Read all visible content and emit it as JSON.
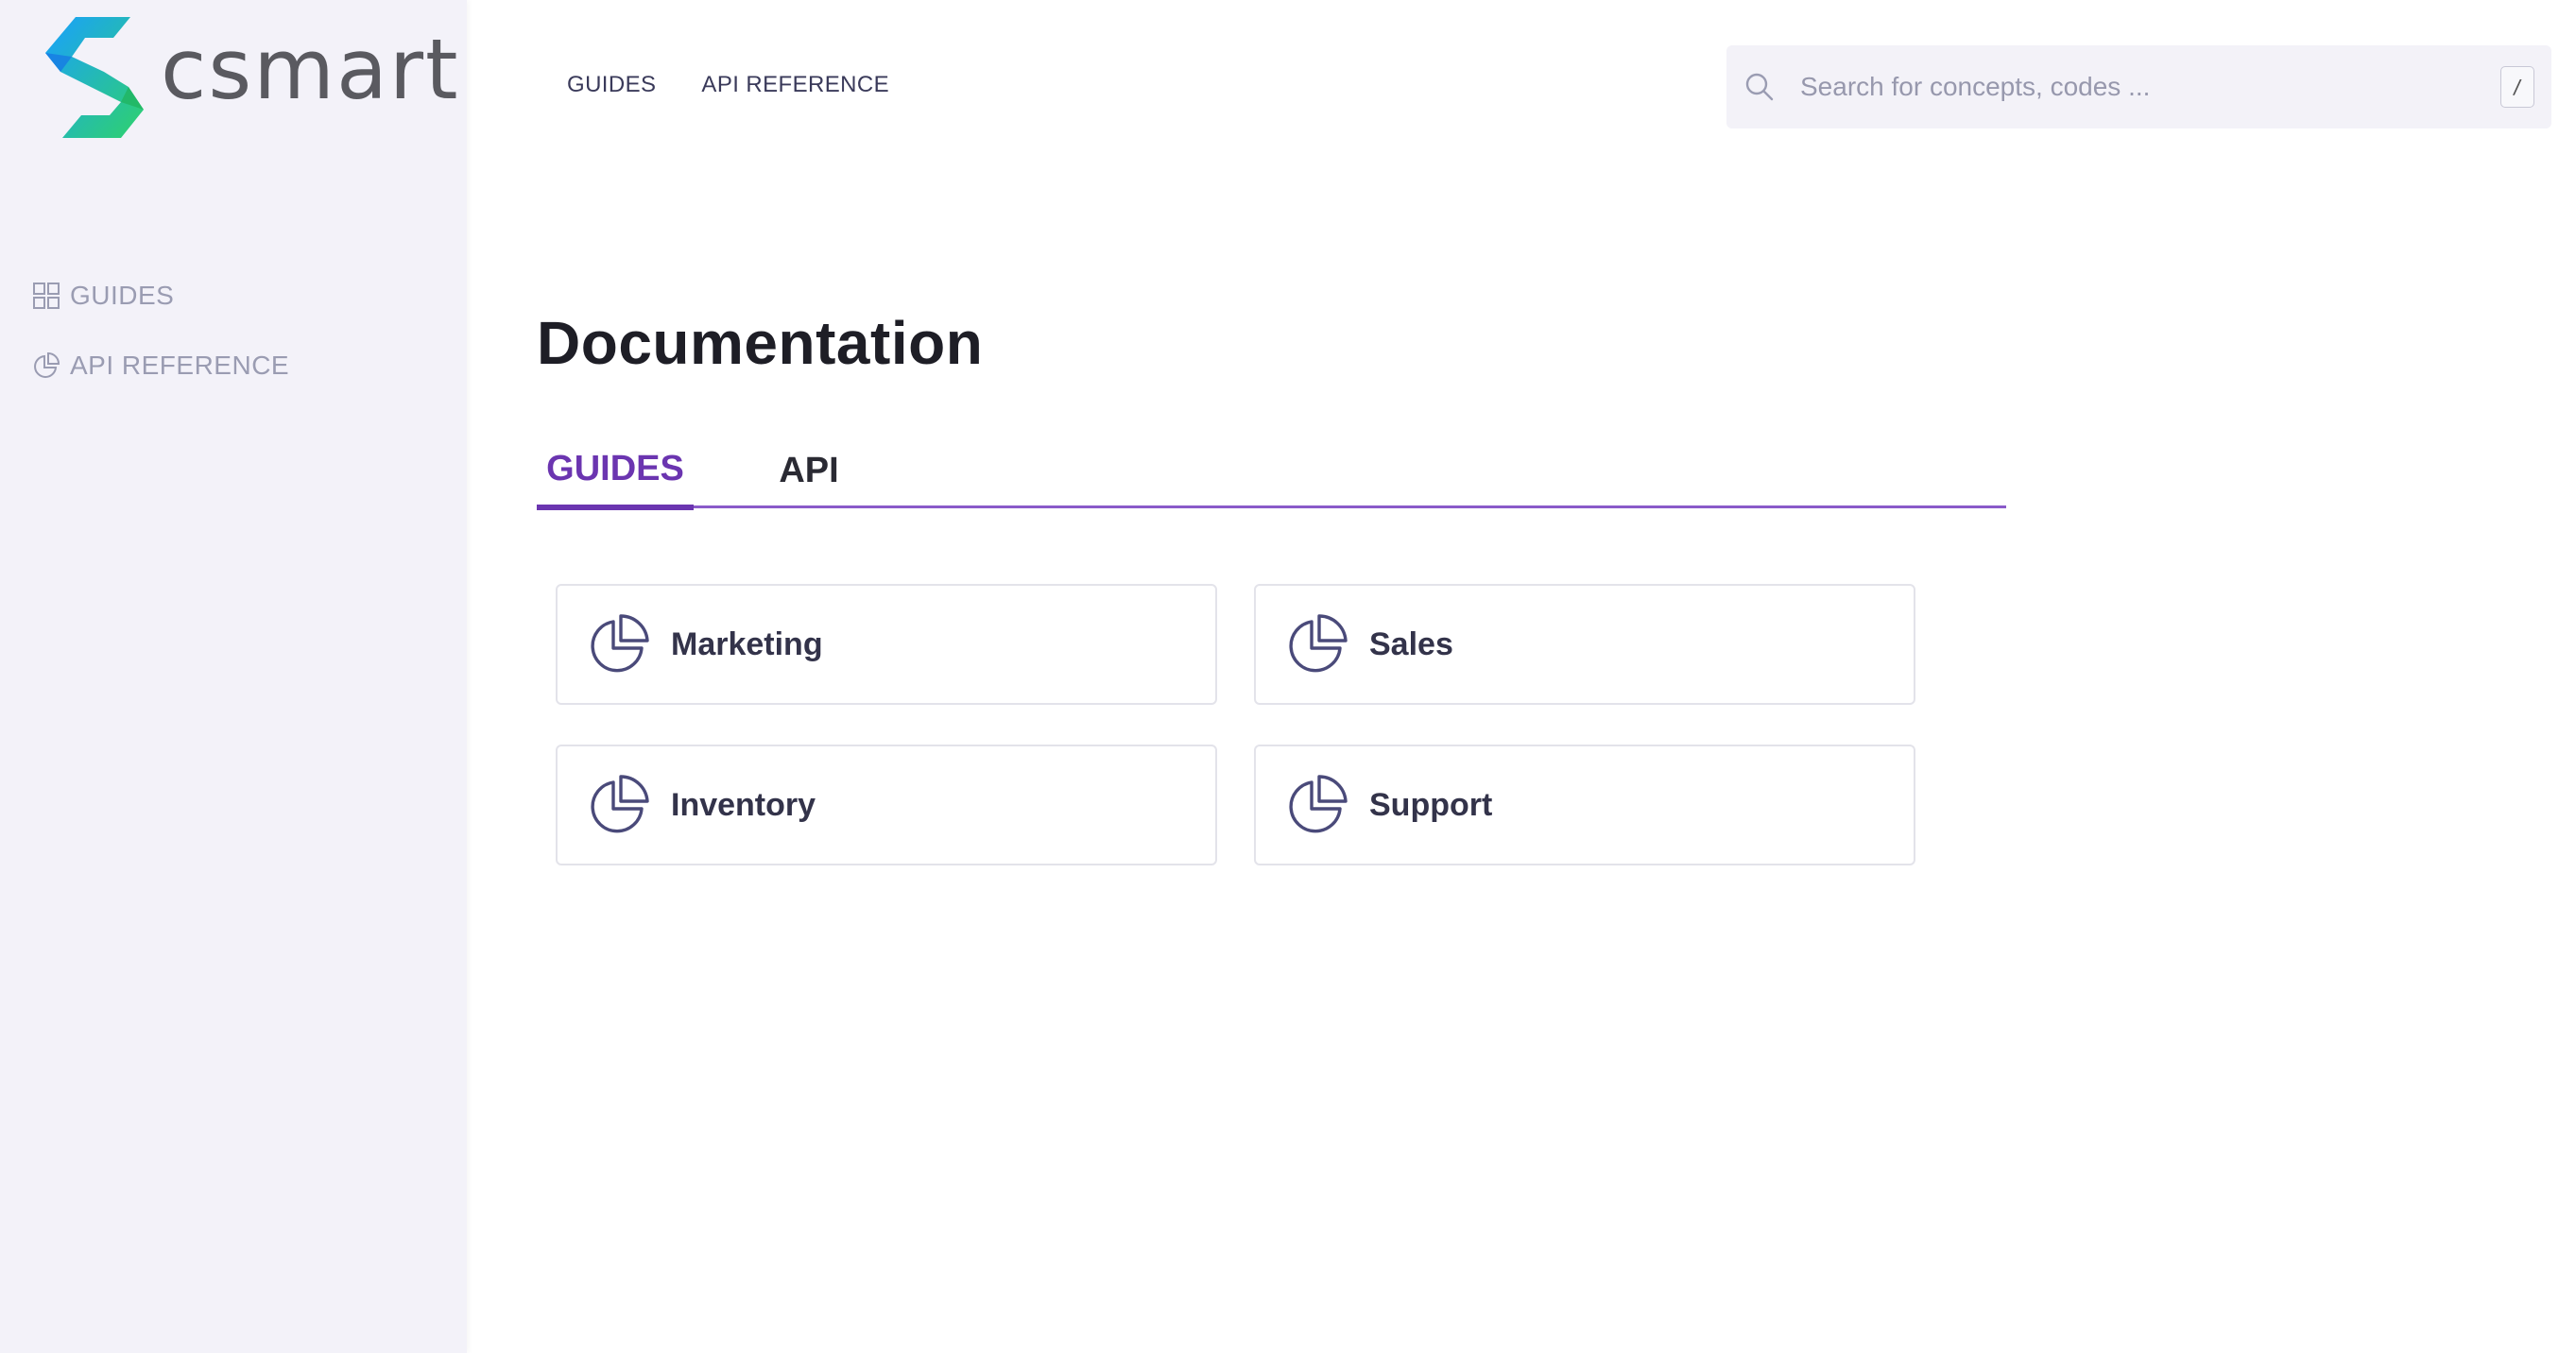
{
  "brand": {
    "name": "csmart",
    "colors": {
      "gradient_start": "#1a8cff",
      "gradient_end": "#2fd26b",
      "accent": "#6b35b0"
    }
  },
  "sidebar": {
    "items": [
      {
        "label": "GUIDES",
        "icon": "grid-icon"
      },
      {
        "label": "API REFERENCE",
        "icon": "pie-chart-icon"
      }
    ]
  },
  "topnav": {
    "items": [
      {
        "label": "GUIDES"
      },
      {
        "label": "API REFERENCE"
      }
    ]
  },
  "search": {
    "placeholder": "Search for concepts, codes ...",
    "shortcut": "/"
  },
  "main": {
    "title": "Documentation",
    "tabs": [
      {
        "label": "GUIDES",
        "active": true
      },
      {
        "label": "API",
        "active": false
      }
    ],
    "cards": [
      {
        "label": "Marketing",
        "icon": "pie-chart-icon"
      },
      {
        "label": "Sales",
        "icon": "pie-chart-icon"
      },
      {
        "label": "Inventory",
        "icon": "pie-chart-icon"
      },
      {
        "label": "Support",
        "icon": "pie-chart-icon"
      }
    ]
  }
}
